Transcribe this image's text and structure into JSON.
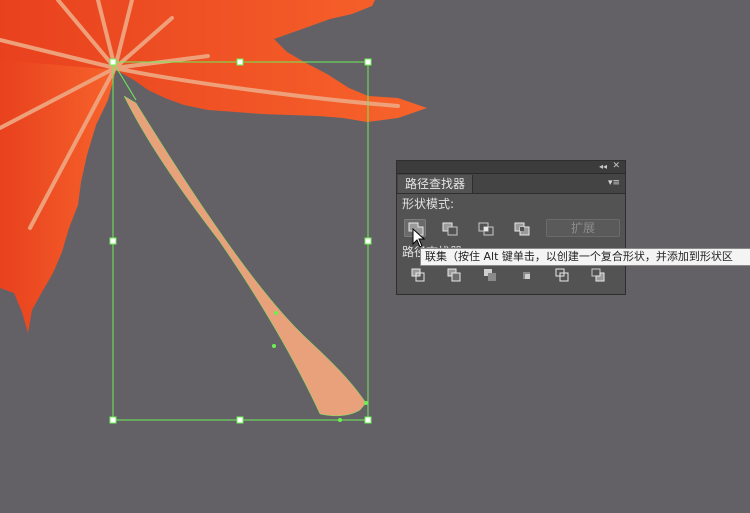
{
  "colors": {
    "canvas_bg": "#646166",
    "leaf_orange_light": "#f7632b",
    "leaf_orange_dark": "#e8411e",
    "leaf_vein": "#eea07a",
    "stem_fill": "#e8a17a",
    "selection_green": "#6cf055"
  },
  "panel": {
    "title": "路径查找器",
    "collapse_icon": "◂◂",
    "close_icon": "✕",
    "menu_icon": "▾≡",
    "shape_modes_label": "形状模式:",
    "shape_modes": [
      {
        "name": "unite",
        "icon": "unite-icon",
        "active": true
      },
      {
        "name": "minus-front",
        "icon": "minus-front-icon",
        "active": false
      },
      {
        "name": "intersect",
        "icon": "intersect-icon",
        "active": false
      },
      {
        "name": "exclude",
        "icon": "exclude-icon",
        "active": false
      }
    ],
    "expand_label": "扩展",
    "pathfinders_label": "路径查找器:",
    "pathfinders": [
      {
        "name": "divide",
        "icon": "divide-icon"
      },
      {
        "name": "trim",
        "icon": "trim-icon"
      },
      {
        "name": "merge",
        "icon": "merge-icon"
      },
      {
        "name": "crop",
        "icon": "crop-icon"
      },
      {
        "name": "outline",
        "icon": "outline-icon"
      },
      {
        "name": "minus-back",
        "icon": "minus-back-icon"
      }
    ]
  },
  "tooltip": {
    "text": "联集（按住 Alt 键单击，以创建一个复合形状，并添加到形状区"
  }
}
